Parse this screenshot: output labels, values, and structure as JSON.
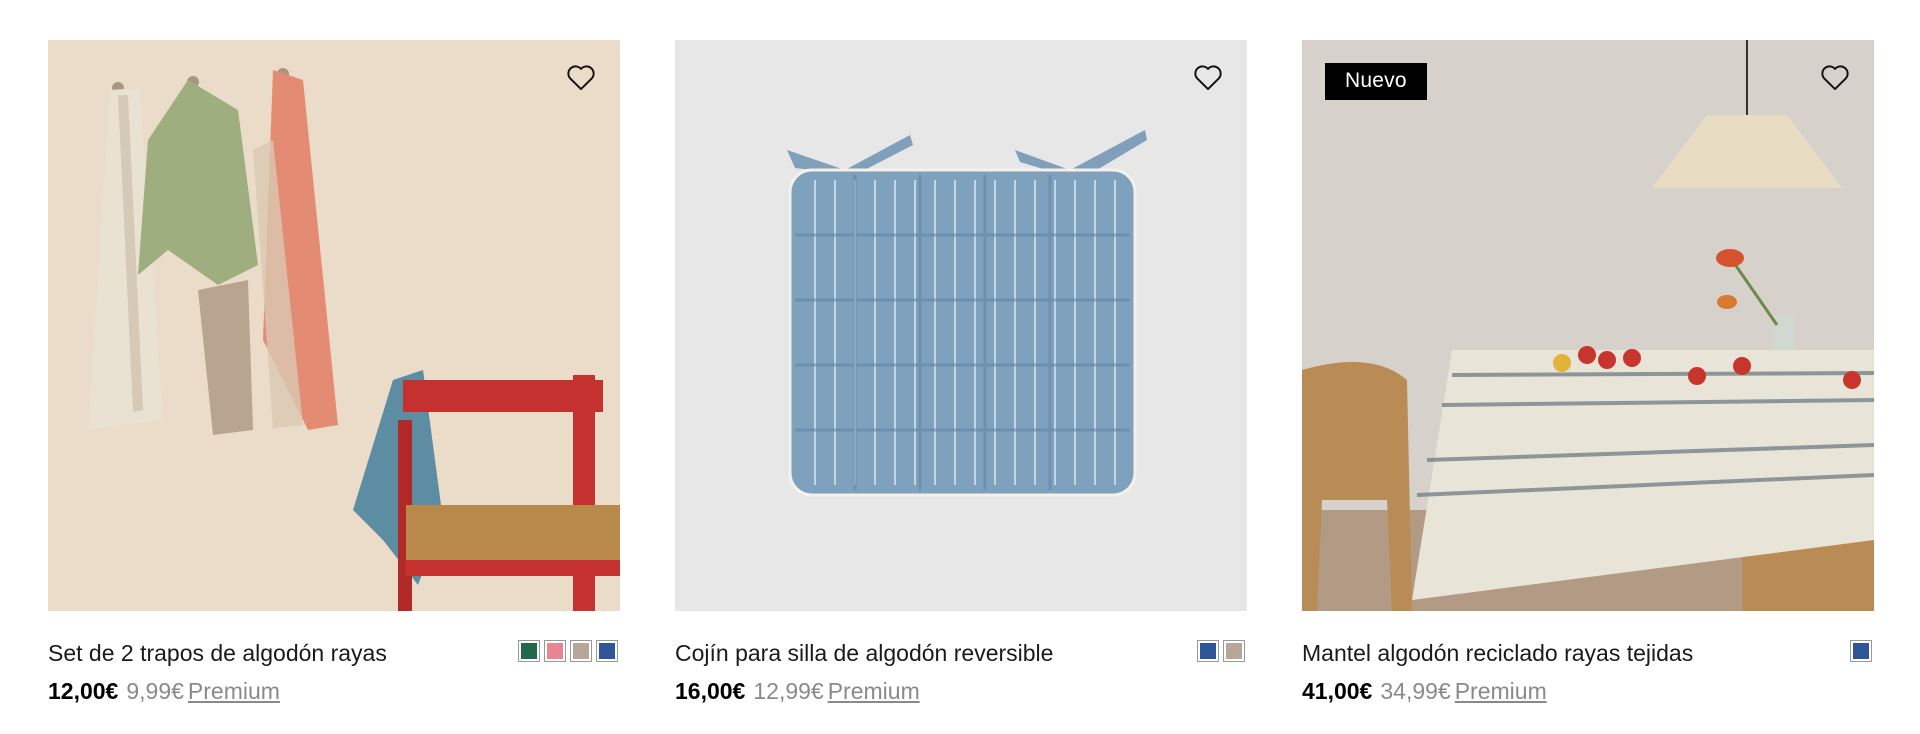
{
  "products": [
    {
      "title": "Set de 2 trapos de algodón rayas",
      "price": "12,00€",
      "old_price": "9,99€",
      "premium_label": "Premium",
      "badge": "",
      "favorite_icon": "heart-outline-icon",
      "swatches": [
        "#1f6a4a",
        "#e88593",
        "#b7a79a",
        "#2d5597"
      ]
    },
    {
      "title": "Cojín para silla de algodón reversible",
      "price": "16,00€",
      "old_price": "12,99€",
      "premium_label": "Premium",
      "badge": "",
      "favorite_icon": "heart-outline-icon",
      "swatches": [
        "#2d5597",
        "#b7a79a"
      ]
    },
    {
      "title": "Mantel algodón reciclado rayas tejidas",
      "price": "41,00€",
      "old_price": "34,99€",
      "premium_label": "Premium",
      "badge": "Nuevo",
      "favorite_icon": "heart-outline-icon",
      "swatches": [
        "#2d5597"
      ]
    }
  ]
}
